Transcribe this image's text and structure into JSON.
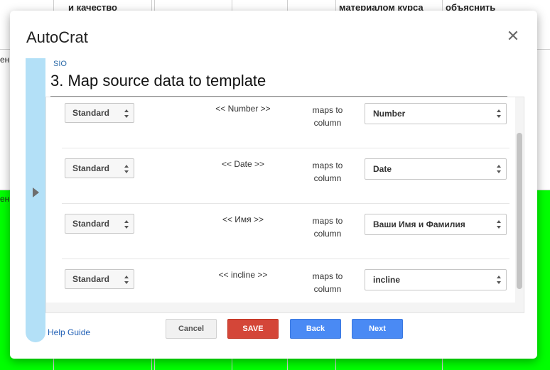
{
  "background": {
    "cells": [
      {
        "text": "и качество"
      },
      {
        "text": "материалом курса"
      },
      {
        "text": "объяснить"
      }
    ],
    "row_fragments": [
      "ен",
      "ен"
    ],
    "highlight_color": "#00ff00"
  },
  "dialog": {
    "title": "AutoCrat",
    "close_icon": "close-icon",
    "project_name": "SIO",
    "step_title": "3. Map source data to template",
    "side_tab_icon": "triangle-right-icon"
  },
  "mappings": [
    {
      "mode": "Standard",
      "field": "<< Number >>",
      "maps_to_line1": "maps to",
      "maps_to_line2": "column",
      "column": "Number"
    },
    {
      "mode": "Standard",
      "field": "<< Date >>",
      "maps_to_line1": "maps to",
      "maps_to_line2": "column",
      "column": "Date"
    },
    {
      "mode": "Standard",
      "field": "<< Имя >>",
      "maps_to_line1": "maps to",
      "maps_to_line2": "column",
      "column": "Ваши Имя и Фамилия"
    },
    {
      "mode": "Standard",
      "field": "<< incline >>",
      "maps_to_line1": "maps to",
      "maps_to_line2": "column",
      "column": "incline"
    }
  ],
  "footer": {
    "help_link": "Help Guide",
    "cancel_label": "Cancel",
    "save_label": "SAVE",
    "back_label": "Back",
    "next_label": "Next"
  },
  "colors": {
    "save": "#d44638",
    "primary": "#4a8af4",
    "side_tab": "#b3e0f7",
    "link": "#1f5fb5"
  }
}
